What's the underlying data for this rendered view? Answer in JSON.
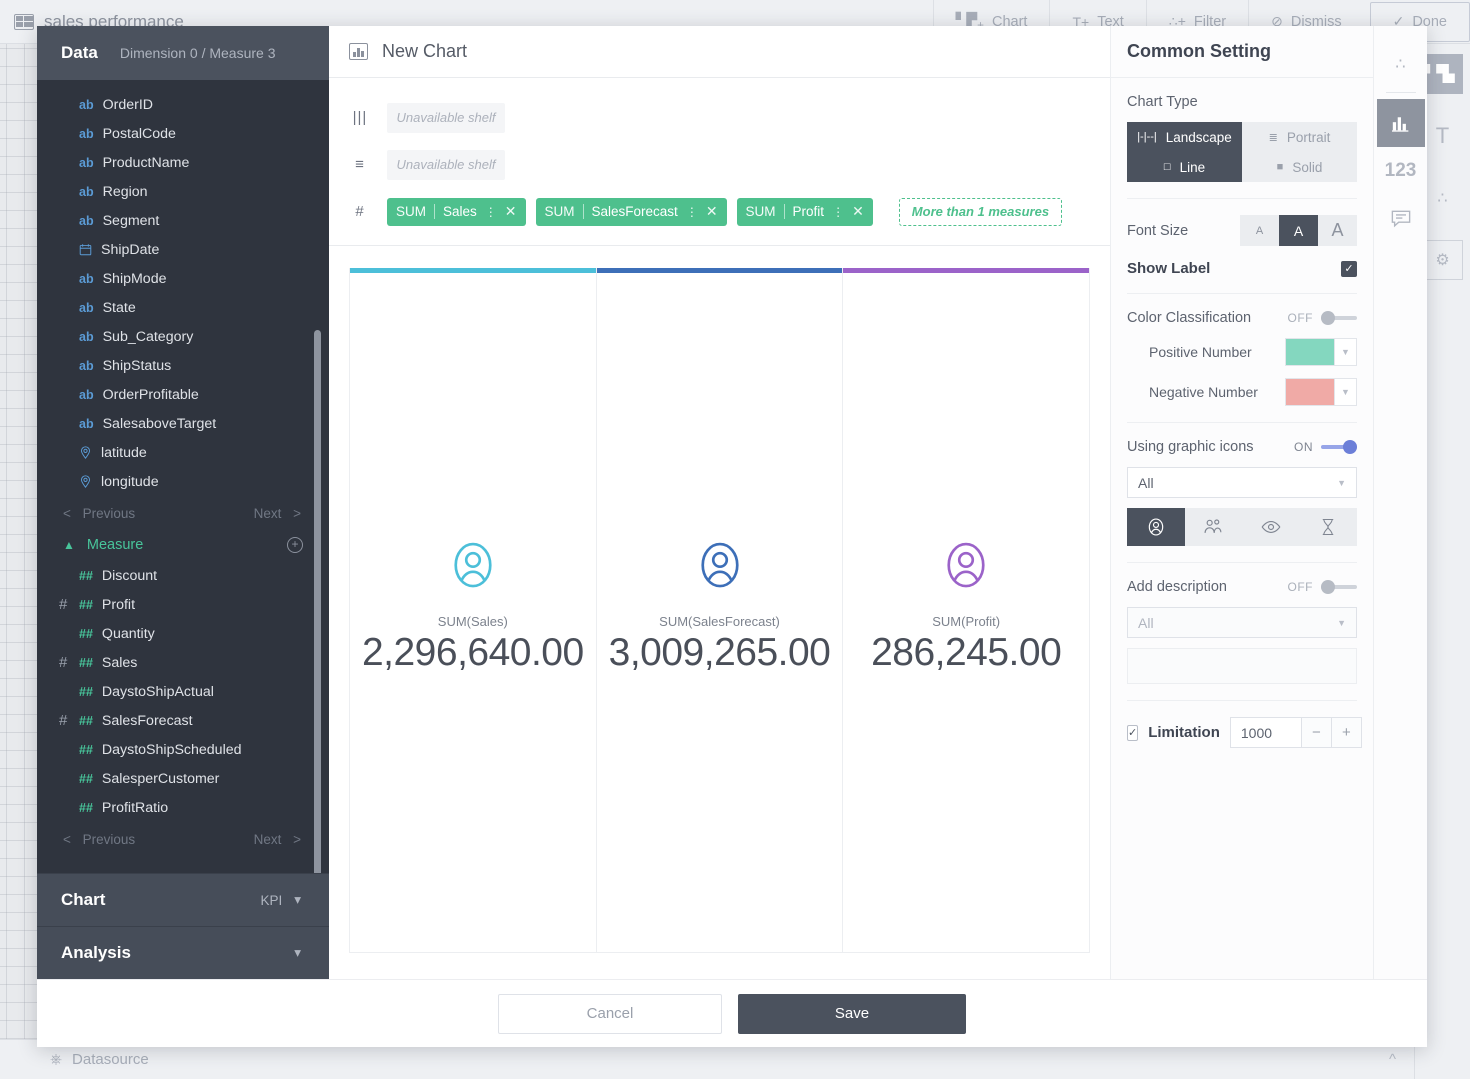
{
  "background": {
    "doc_title": "sales performance",
    "actions": [
      {
        "label": "Chart",
        "icon": "chart-add-icon"
      },
      {
        "label": "Text",
        "icon": "text-add-icon"
      },
      {
        "label": "Filter",
        "icon": "filter-add-icon"
      },
      {
        "label": "Dismiss",
        "icon": "dismiss-icon"
      },
      {
        "label": "Done",
        "icon": "check-icon"
      }
    ],
    "bottom_bar": {
      "label": "Datasource",
      "icon": "database-icon"
    },
    "rail_icons": [
      "chart-bar-icon",
      "text-icon",
      "filter-dots-icon",
      "gear-box-icon"
    ]
  },
  "data_panel": {
    "title": "Data",
    "summary": "Dimension 0 / Measure 3",
    "dimension_fields": [
      {
        "name": "OrderID",
        "type": "ab",
        "icon": "text-field-icon",
        "used": false
      },
      {
        "name": "PostalCode",
        "type": "ab",
        "icon": "text-field-icon",
        "used": false
      },
      {
        "name": "ProductName",
        "type": "ab",
        "icon": "text-field-icon",
        "used": false
      },
      {
        "name": "Region",
        "type": "ab",
        "icon": "text-field-icon",
        "used": false
      },
      {
        "name": "Segment",
        "type": "ab",
        "icon": "text-field-icon",
        "used": false
      },
      {
        "name": "ShipDate",
        "type": "date",
        "icon": "calendar-icon",
        "used": false
      },
      {
        "name": "ShipMode",
        "type": "ab",
        "icon": "text-field-icon",
        "used": false
      },
      {
        "name": "State",
        "type": "ab",
        "icon": "text-field-icon",
        "used": false
      },
      {
        "name": "Sub_Category",
        "type": "ab",
        "icon": "text-field-icon",
        "used": false
      },
      {
        "name": "ShipStatus",
        "type": "ab",
        "icon": "text-field-icon",
        "used": false
      },
      {
        "name": "OrderProfitable",
        "type": "ab",
        "icon": "text-field-icon",
        "used": false
      },
      {
        "name": "SalesaboveTarget",
        "type": "ab",
        "icon": "text-field-icon",
        "used": false
      },
      {
        "name": "latitude",
        "type": "geo",
        "icon": "location-pin-icon",
        "used": false
      },
      {
        "name": "longitude",
        "type": "geo",
        "icon": "location-pin-icon",
        "used": false
      }
    ],
    "dimension_pager": {
      "previous": "Previous",
      "next": "Next"
    },
    "measure_group": {
      "title": "Measure",
      "add": "+"
    },
    "measure_fields": [
      {
        "name": "Discount",
        "type": "##",
        "used": false
      },
      {
        "name": "Profit",
        "type": "##",
        "used": true
      },
      {
        "name": "Quantity",
        "type": "##",
        "used": false
      },
      {
        "name": "Sales",
        "type": "##",
        "used": true
      },
      {
        "name": "DaystoShipActual",
        "type": "##",
        "used": false
      },
      {
        "name": "SalesForecast",
        "type": "##",
        "used": true
      },
      {
        "name": "DaystoShipScheduled",
        "type": "##",
        "used": false
      },
      {
        "name": "SalesperCustomer",
        "type": "##",
        "used": false
      },
      {
        "name": "ProfitRatio",
        "type": "##",
        "used": false
      }
    ],
    "measure_pager": {
      "previous": "Previous",
      "next": "Next"
    },
    "accordions": [
      {
        "title": "Chart",
        "value": "KPI"
      },
      {
        "title": "Analysis",
        "value": ""
      }
    ]
  },
  "center": {
    "chart_title": "New Chart",
    "shelves": [
      {
        "icon": "columns-shelf-icon",
        "placeholder": "Unavailable  shelf",
        "pills": []
      },
      {
        "icon": "rows-shelf-icon",
        "placeholder": "Unavailable  shelf",
        "pills": []
      },
      {
        "icon": "measure-shelf-icon",
        "placeholder": "",
        "pills": [
          {
            "agg": "SUM",
            "field": "Sales"
          },
          {
            "agg": "SUM",
            "field": "SalesForecast"
          },
          {
            "agg": "SUM",
            "field": "Profit"
          }
        ],
        "hint": "More than 1 measures"
      }
    ]
  },
  "chart_data": {
    "type": "table",
    "title": "New Chart",
    "chart_kind": "KPI",
    "cards": [
      {
        "label": "SUM(Sales)",
        "value": "2,296,640.00",
        "numeric": 2296640.0,
        "color": "#4cbfd9",
        "icon": "person-icon"
      },
      {
        "label": "SUM(SalesForecast)",
        "value": "3,009,265.00",
        "numeric": 3009265.0,
        "color": "#3d6fb8",
        "icon": "person-icon"
      },
      {
        "label": "SUM(Profit)",
        "value": "286,245.00",
        "numeric": 286245.0,
        "color": "#9b63c9",
        "icon": "person-icon"
      }
    ]
  },
  "settings": {
    "title": "Common Setting",
    "chart_type": {
      "label": "Chart Type",
      "options": [
        {
          "label": "Landscape",
          "icon": "landscape-icon",
          "active": true
        },
        {
          "label": "Portrait",
          "icon": "portrait-icon",
          "active": false
        },
        {
          "label": "Line",
          "icon": "line-style-icon",
          "active": true
        },
        {
          "label": "Solid",
          "icon": "solid-style-icon",
          "active": false
        }
      ]
    },
    "font_size": {
      "label": "Font Size",
      "options": [
        "A",
        "A",
        "A"
      ],
      "selected_index": 1
    },
    "show_label": {
      "label": "Show Label",
      "checked": true
    },
    "color_classification": {
      "label": "Color Classification",
      "state": "OFF",
      "positive": {
        "label": "Positive Number",
        "color": "#84d7bf"
      },
      "negative": {
        "label": "Negative Number",
        "color": "#f0aaa6"
      }
    },
    "graphic_icons": {
      "label": "Using graphic icons",
      "state": "ON",
      "select_value": "All",
      "choices": [
        {
          "icon": "person-icon",
          "active": true
        },
        {
          "icon": "group-icon",
          "active": false
        },
        {
          "icon": "eye-icon",
          "active": false
        },
        {
          "icon": "hourglass-icon",
          "active": false
        }
      ]
    },
    "add_description": {
      "label": "Add description",
      "state": "OFF",
      "select_value": "All",
      "text_value": ""
    },
    "limitation": {
      "label": "Limitation",
      "checked": true,
      "value": "1000",
      "minus": "−",
      "plus": "+"
    },
    "rail": [
      {
        "icon": "filter-dots-icon",
        "active": false
      },
      {
        "icon": "chart-bar-icon",
        "active": true
      },
      {
        "icon": "number-123-icon",
        "label": "123",
        "active": false
      },
      {
        "icon": "comment-icon",
        "active": false
      }
    ]
  },
  "footer": {
    "cancel": "Cancel",
    "save": "Save"
  }
}
